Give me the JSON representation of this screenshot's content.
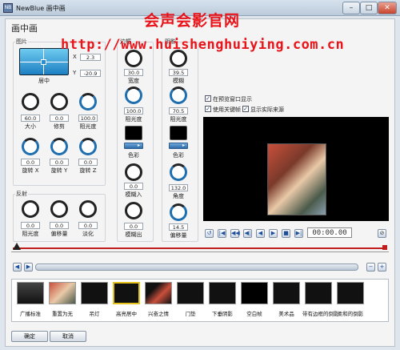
{
  "window": {
    "title": "NewBlue 画中画",
    "app_icon": "NB"
  },
  "panel_title": "画中画",
  "watermark": {
    "title": "会声会影官网",
    "url": "http://www.huishenghuiying.com.cn"
  },
  "image_group": {
    "label": "图片",
    "x_label": "X",
    "x_value": "2.3",
    "y_label": "Y",
    "y_value": "-20.9",
    "position_label": "居中",
    "knobs": [
      {
        "value": "60.0",
        "label": "大小"
      },
      {
        "value": "0.0",
        "label": "修剪"
      },
      {
        "value": "100.0",
        "label": "阻光度"
      },
      {
        "value": "0.0",
        "label": "旋转 X"
      },
      {
        "value": "0.0",
        "label": "旋转 Y"
      },
      {
        "value": "0.0",
        "label": "旋转 Z"
      }
    ]
  },
  "reflection_group": {
    "label": "反射",
    "knobs": [
      {
        "value": "0.0",
        "label": "阻光度"
      },
      {
        "value": "0.0",
        "label": "偏移量"
      },
      {
        "value": "0.0",
        "label": "淡化"
      }
    ]
  },
  "border_group": {
    "label": "边框",
    "knobs": [
      {
        "value": "30.0",
        "label": "宽度"
      },
      {
        "value": "100.0",
        "label": "阻光度"
      }
    ],
    "color_label": "色彩",
    "knobs2": [
      {
        "value": "0.0",
        "label": "模糊入"
      },
      {
        "value": "0.0",
        "label": "模糊出"
      }
    ]
  },
  "shadow_group": {
    "label": "阴影",
    "knobs": [
      {
        "value": "39.5",
        "label": "模糊"
      },
      {
        "value": "70.5",
        "label": "阻光度"
      }
    ],
    "color_label": "色彩",
    "knobs2": [
      {
        "value": "132.0",
        "label": "角度"
      },
      {
        "value": "14.5",
        "label": "偏移量"
      }
    ]
  },
  "options": [
    {
      "label": "在预览窗口显示",
      "checked": true
    },
    {
      "label": "使用关键帧",
      "checked": true
    },
    {
      "label": "显示实际来源",
      "checked": true
    }
  ],
  "transport": {
    "buttons": [
      "↺",
      "|◀",
      "◀◀",
      "◀|",
      "◀",
      "▶",
      "■",
      "▶|",
      "▶▶",
      "▶|"
    ],
    "timecode": "00:00.00",
    "settings_icon": "⊘"
  },
  "timeline": {
    "zoom_out": "−",
    "zoom_in": "+",
    "prev": "◀",
    "next": "▶"
  },
  "presets": [
    {
      "label": "广播标准"
    },
    {
      "label": "重置为无"
    },
    {
      "label": "吊灯"
    },
    {
      "label": "高亮居中"
    },
    {
      "label": "兴奋之情"
    },
    {
      "label": "门垫"
    },
    {
      "label": "下垂阴影"
    },
    {
      "label": "空白帧"
    },
    {
      "label": "美术品"
    },
    {
      "label": "带有边框的倒影"
    },
    {
      "label": "柔和的倒影"
    }
  ],
  "buttons": {
    "ok": "确定",
    "cancel": "取消"
  },
  "colors": {
    "accent": "#1f6fb0",
    "watermark": "#e8141a",
    "preview_bg": "#000000"
  }
}
